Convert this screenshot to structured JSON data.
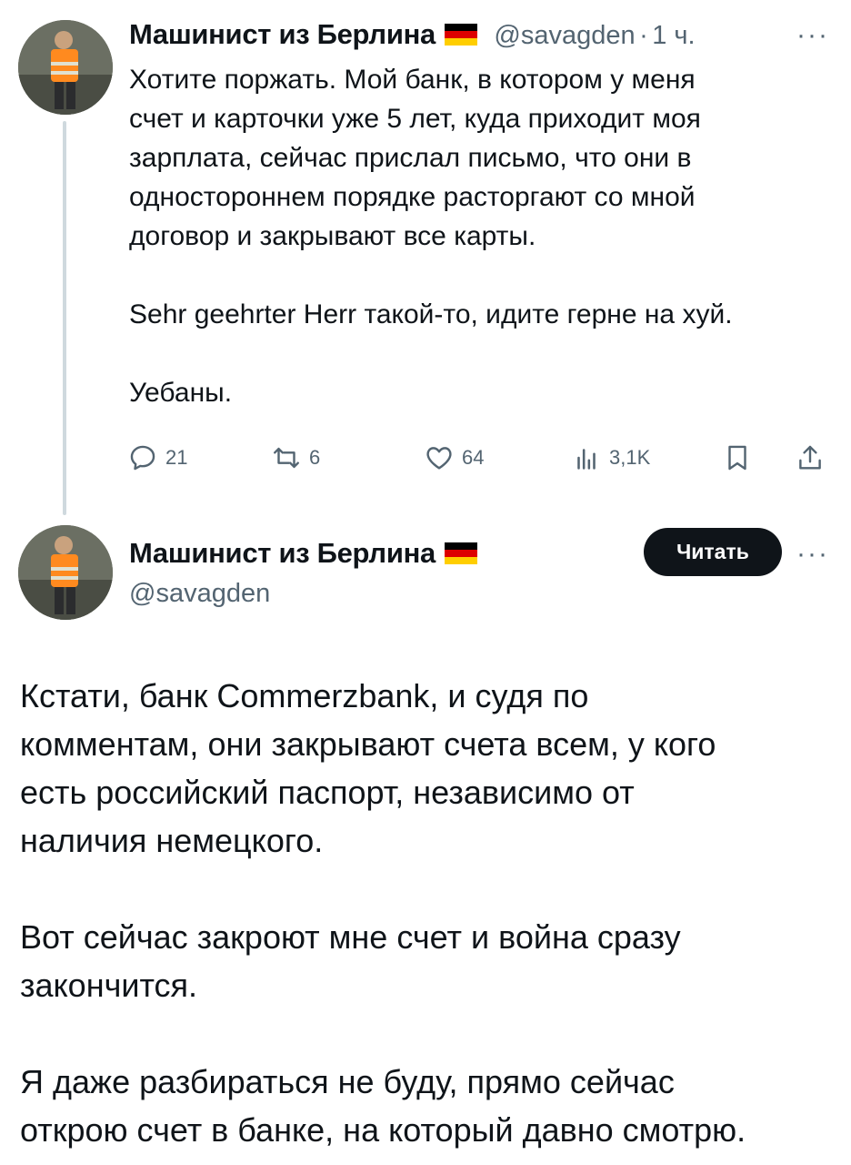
{
  "tweet1": {
    "author_name": "Машинист из Берлина",
    "handle": "@savagden",
    "separator": "·",
    "time": "1 ч.",
    "more": "···",
    "text": [
      "Хотите поржать. Мой банк, в котором у меня",
      "счет и карточки уже 5 лет, куда приходит моя",
      "зарплата, сейчас прислал письмо, что они в",
      "одностороннем порядке расторгают со мной",
      "договор и закрывают все карты.",
      "",
      "Sehr geehrter Herr такой-то, идите герне на хуй.",
      "",
      "Уебаны."
    ],
    "actions": {
      "replies": "21",
      "reposts": "6",
      "likes": "64",
      "views": "3,1K"
    }
  },
  "tweet2": {
    "author_name": "Машинист из Берлина",
    "handle": "@savagden",
    "follow_label": "Читать",
    "more": "···",
    "text": [
      "Кстати, банк Commerzbank, и судя по",
      "комментам, они закрывают счета всем, у кого",
      "есть российский паспорт, независимо от",
      "наличия немецкого.",
      "",
      "Вот сейчас закроют мне счет и война сразу",
      "закончится.",
      "",
      "Я даже разбираться не буду, прямо сейчас",
      "открою счет в банке, на который давно смотрю."
    ]
  },
  "icons": {
    "reply": "reply-icon",
    "repost": "repost-icon",
    "like": "like-icon",
    "views": "views-icon",
    "bookmark": "bookmark-icon",
    "share": "share-icon",
    "flag": "germany-flag-icon"
  },
  "colors": {
    "text": "#0f1419",
    "secondary": "#536471",
    "thread_line": "#cfd9de",
    "button_bg": "#0f1419"
  }
}
